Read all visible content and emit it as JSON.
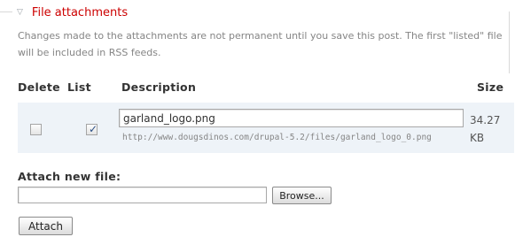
{
  "fieldset": {
    "legend": "File attachments",
    "collapse_icon": "triangle-down-icon",
    "description": "Changes made to the attachments are not permanent until you save this post. The first \"listed\" file will be included in RSS feeds."
  },
  "table": {
    "headers": {
      "delete": "Delete",
      "list": "List",
      "description": "Description",
      "size": "Size"
    },
    "rows": [
      {
        "delete_checked": false,
        "list_checked": true,
        "description": "garland_logo.png",
        "url": "http://www.dougsdinos.com/drupal-5.2/files/garland_logo_0.png",
        "size": "34.27 KB"
      }
    ]
  },
  "attach": {
    "label": "Attach new file:",
    "file_value": "",
    "browse_label": "Browse...",
    "attach_button": "Attach"
  },
  "colors": {
    "legend": "#cc0000",
    "row_background": "#eef3f8",
    "muted_text": "#858585"
  }
}
